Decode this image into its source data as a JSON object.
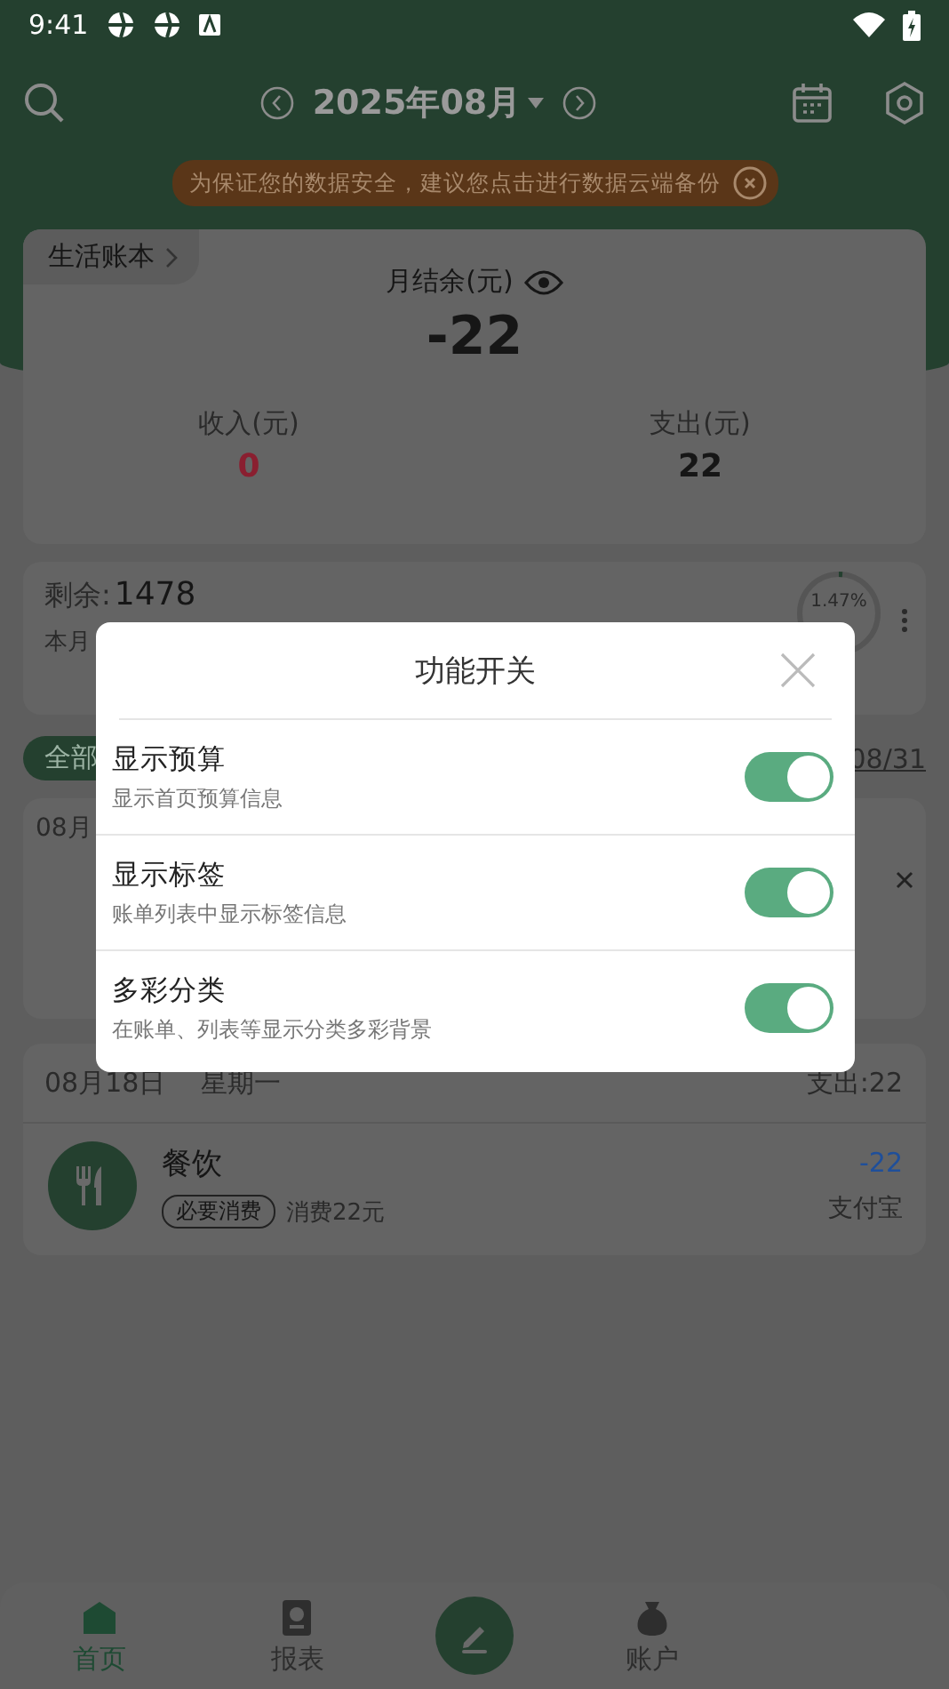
{
  "status_bar": {
    "time": "9:41"
  },
  "header": {
    "month": "2025年08月",
    "backup_notice": "为保证您的数据安全，建议您点击进行数据云端备份"
  },
  "summary": {
    "book": "生活账本",
    "balance_label": "月结余(元)",
    "balance": "-22",
    "income_label": "收入(元)",
    "income": "0",
    "expense_label": "支出(元)",
    "expense": "22"
  },
  "budget": {
    "remaining_label": "剩余:",
    "remaining": "1478",
    "month_label": "本月",
    "percent": "1.47%",
    "level": 0.0147
  },
  "filter": {
    "label": "全部",
    "end_date": "08/31"
  },
  "ad_card": {
    "date": "08月"
  },
  "day": {
    "date": "08月18日",
    "weekday": "星期一",
    "expense": "支出:22",
    "entries": [
      {
        "category": "餐饮",
        "tag": "必要消费",
        "note": "消费22元",
        "amount": "-22",
        "account": "支付宝"
      }
    ]
  },
  "tabs": [
    {
      "label": "首页",
      "selected": true
    },
    {
      "label": "报表",
      "selected": false
    },
    {
      "kind": "compose"
    },
    {
      "label": "账户",
      "selected": false
    }
  ],
  "dialog": {
    "title": "功能开关",
    "items": [
      {
        "title": "显示预算",
        "subtitle": "显示首页预算信息",
        "on": true
      },
      {
        "title": "显示标签",
        "subtitle": "账单列表中显示标签信息",
        "on": true
      },
      {
        "title": "多彩分类",
        "subtitle": "在账单、列表等显示分类多彩背景",
        "on": true
      }
    ]
  }
}
